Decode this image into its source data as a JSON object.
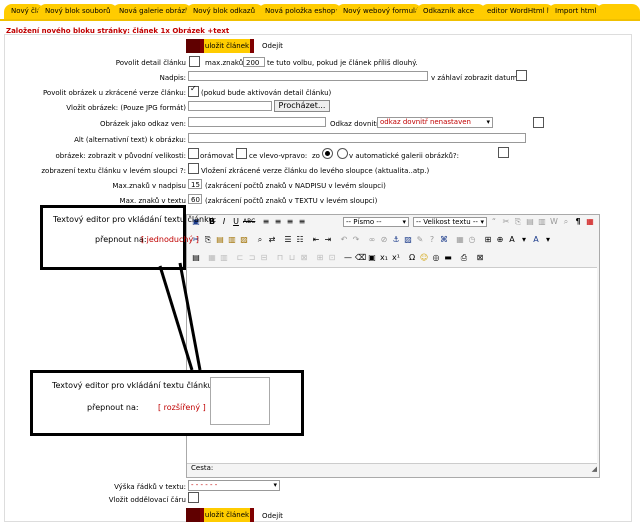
{
  "tabs": [
    "Nový článek",
    "Nový blok souborů",
    "Nová galerie obrázků",
    "Nový blok odkazů",
    "Nová položka eshopu",
    "Nový webový formulář",
    "Odkazník akce",
    "editor WordHtml kód",
    "Import html"
  ],
  "page_title": "Založení nového bloku stránky: článek 1x Obrázek +text",
  "actions": {
    "save": "uložit článek",
    "leave": "Odejít"
  },
  "fields": {
    "allow_detail": {
      "label": "Povolit detail článku",
      "hint": "max.znaků:",
      "value": "200",
      "note": "te tuto volbu, pokud je článek příliš dlouhý."
    },
    "heading": {
      "label": "Nadpis:",
      "note": "v záhlaví zobrazit datum:"
    },
    "allow_image": {
      "label": "Povolit obrázek u zkrácené verze článku:",
      "note": "(pokud bude aktivován detail článku)"
    },
    "insert_image": {
      "label": "Vložit obrázek: (Pouze JPG formát)",
      "browse": "Procházet..."
    },
    "image_link": {
      "label": "Obrázek jako odkaz ven:",
      "inside_label": "Odkaz dovnitř:",
      "inside_value": "odkaz dovnitř nenastaven"
    },
    "alt": {
      "label": "Alt (alternativní text) k obrázku:"
    },
    "orig_size": {
      "label": "obrázek: zobrazit v původní velikosti:",
      "opt1": "orámovat",
      "opt2": "ce vlevo-vpravo:",
      "opt3": "zo",
      "opt4": "v automatické galerii obrázků?:"
    },
    "show_text": {
      "label": "zobrazení textu článku v levém sloupci ?:",
      "note": "Vložení zkrácené verze článku do levého sloupce (aktualita..atp.)"
    },
    "max_heading": {
      "label": "Max.znaků v nadpisu",
      "value": "15",
      "note": "(zakrácení počtů znaků v NADPISU v levém sloupci)"
    },
    "max_text": {
      "label": "Max. znaků v textu",
      "value": "60",
      "note": "(zakrácení počtů znaků v TEXTU v levém sloupci)"
    },
    "row_height": {
      "label": "Výška řádků v textu:",
      "value": "- - - - - -"
    },
    "divider": {
      "label": "Vložit oddělovací čáru"
    }
  },
  "editor": {
    "label": "Textový editor pro vkládání textu článku:",
    "switch_label": "přepnout na:",
    "switch_simple": "[ jednoduchý ]",
    "switch_extended": "[ rozšířený ]",
    "format": "-- Písmo --",
    "size": "-- Velikost textu --",
    "path_label": "Cesta:"
  },
  "callout_bottom": {
    "label": "Textový editor pro vkládání textu článku:",
    "switch_label": "přepnout na:",
    "switch_value": "[ rozšířený ]"
  }
}
